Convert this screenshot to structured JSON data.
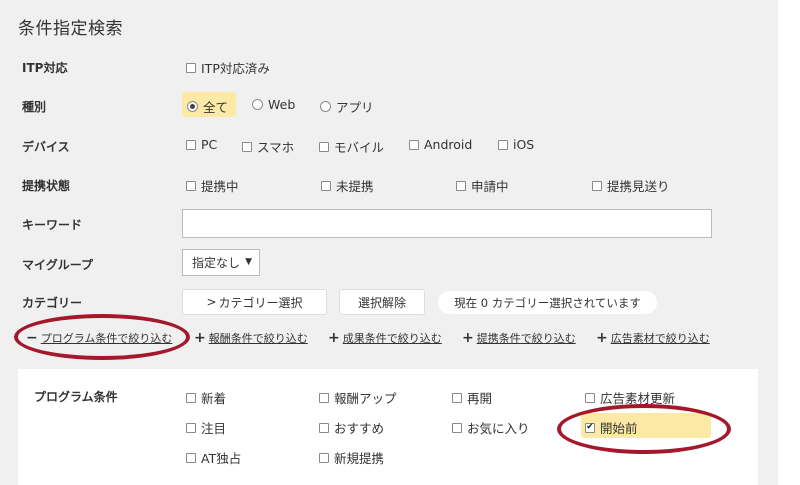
{
  "title": "条件指定検索",
  "itp": {
    "label": "ITP対応",
    "option": "ITP対応済み"
  },
  "type": {
    "label": "種別",
    "options": [
      "全て",
      "Web",
      "アプリ"
    ]
  },
  "device": {
    "label": "デバイス",
    "options": [
      "PC",
      "スマホ",
      "モバイル",
      "Android",
      "iOS"
    ]
  },
  "affiliation": {
    "label": "提携状態",
    "options": [
      "提携中",
      "未提携",
      "申請中",
      "提携見送り"
    ]
  },
  "keyword": {
    "label": "キーワード",
    "value": ""
  },
  "mygroup": {
    "label": "マイグループ",
    "selected": "指定なし"
  },
  "category": {
    "label": "カテゴリー",
    "select_button": "カテゴリー選択",
    "clear_button": "選択解除",
    "status": "現在 0 カテゴリー選択されています"
  },
  "filters": {
    "program": "プログラム条件で絞り込む",
    "reward": "報酬条件で絞り込む",
    "result": "成果条件で絞り込む",
    "partner": "提携条件で絞り込む",
    "creative": "広告素材で絞り込む"
  },
  "program_conditions": {
    "label": "プログラム条件",
    "options": [
      "新着",
      "報酬アップ",
      "再開",
      "広告素材更新",
      "注目",
      "おすすめ",
      "お気に入り",
      "開始前",
      "AT独占",
      "新規提携"
    ],
    "checked": "開始前"
  },
  "colors": {
    "highlight": "#fde9a6",
    "annotation": "#a3182a",
    "panel": "#f0f0f0"
  }
}
